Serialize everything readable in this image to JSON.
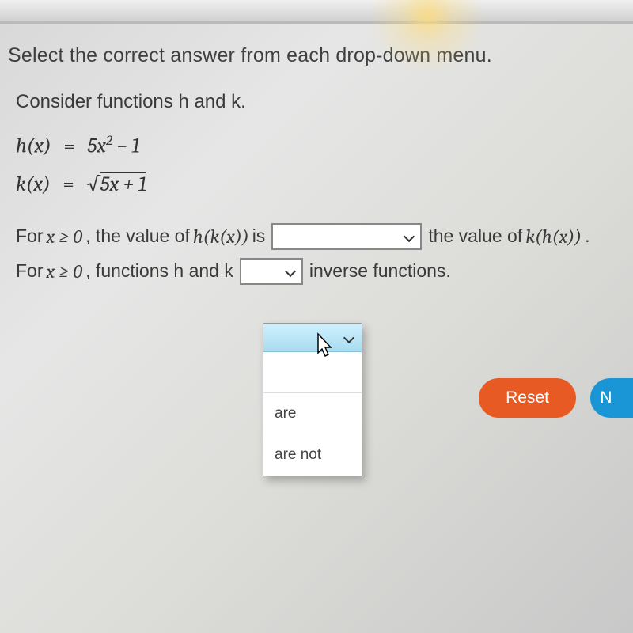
{
  "instruction": "Select the correct answer from each drop-down menu.",
  "consider": "Consider functions h and k.",
  "equations": {
    "h": {
      "lhs": "h(x)",
      "eq": "=",
      "rhs_a": "5x",
      "sup": "2",
      "rhs_b": " − 1"
    },
    "k": {
      "lhs": "k(x)",
      "eq": "=",
      "radical": "√",
      "under": "5x + 1"
    }
  },
  "line1": {
    "pre": "For ",
    "cond": "x ≥ 0",
    "mid1": ", the value of ",
    "exprA": "h(k(x))",
    "mid2": " is",
    "post1": " the value of ",
    "exprB": "k(h(x))",
    "end": "."
  },
  "line2": {
    "pre": "For ",
    "cond": "x ≥ 0",
    "mid": ", functions h and k",
    "post": " inverse functions."
  },
  "dropdown": {
    "blank": "",
    "opt1": "are",
    "opt2": "are not"
  },
  "buttons": {
    "reset": "Reset",
    "next": "N"
  }
}
